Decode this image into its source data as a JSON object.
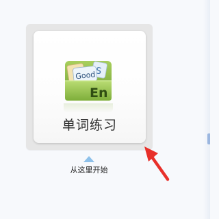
{
  "tile": {
    "label": "单词练习",
    "icon": "vocabulary-cards-icon",
    "icon_texts": {
      "card1": "D",
      "card2": "Good",
      "card3": "S",
      "card4": "En"
    }
  },
  "hint": {
    "text": "从这里开始",
    "marker_icon": "up-triangle-icon",
    "arrow_icon": "red-arrow-icon"
  },
  "colors": {
    "arrow": "#e8302a",
    "icon_green": "#8cbb48",
    "marker_blue": "#8ec1ea"
  }
}
